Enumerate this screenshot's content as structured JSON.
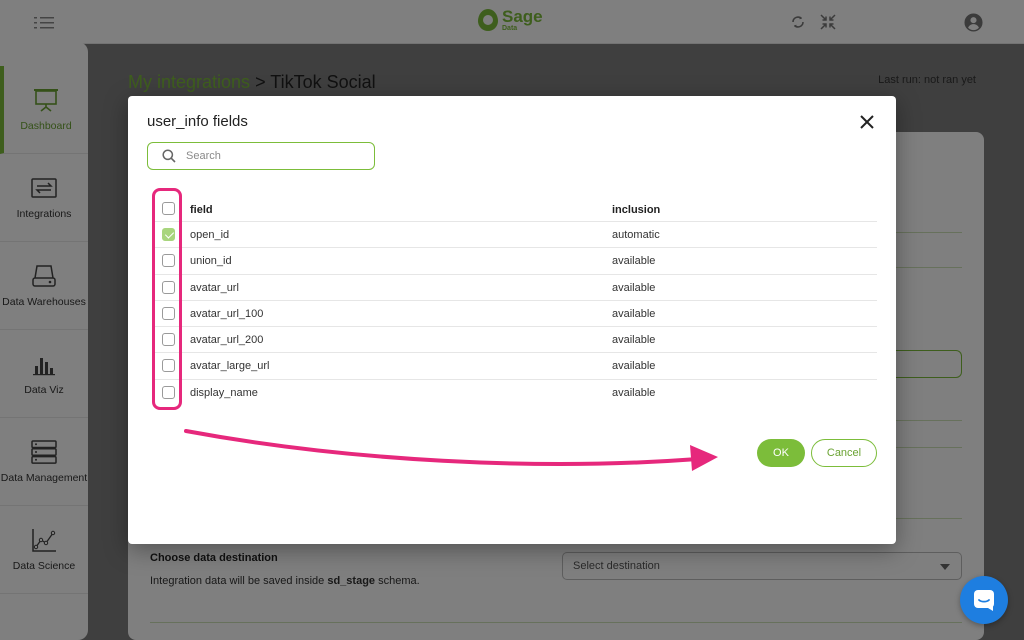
{
  "header": {
    "logo_name": "Sage",
    "logo_sub": "Data",
    "icons": [
      "menu-icon",
      "sync-icon",
      "compress-icon",
      "account-icon"
    ]
  },
  "sidebar": {
    "items": [
      {
        "label": "Dashboard",
        "icon": "presentation-icon",
        "active": true
      },
      {
        "label": "Integrations",
        "icon": "swap-icon"
      },
      {
        "label": "Data Warehouses",
        "icon": "storage-icon"
      },
      {
        "label": "Data Viz",
        "icon": "bar-chart-icon"
      },
      {
        "label": "Data Management",
        "icon": "server-icon"
      },
      {
        "label": "Data Science",
        "icon": "scatter-chart-icon"
      }
    ]
  },
  "page": {
    "breadcrumb_link": "My integrations",
    "breadcrumb_rest": " > TikTok Social",
    "last_run": "Last run: not ran yet",
    "destination_title": "Choose data destination",
    "destination_desc_prefix": "Integration data will be saved inside ",
    "destination_schema": "sd_stage",
    "destination_desc_suffix": " schema.",
    "destination_placeholder": "Select destination"
  },
  "modal": {
    "title": "user_info fields",
    "search_placeholder": "Search",
    "columns": {
      "field": "field",
      "inclusion": "inclusion"
    },
    "rows": [
      {
        "field": "open_id",
        "inclusion": "automatic",
        "checked": true
      },
      {
        "field": "union_id",
        "inclusion": "available",
        "checked": false
      },
      {
        "field": "avatar_url",
        "inclusion": "available",
        "checked": false
      },
      {
        "field": "avatar_url_100",
        "inclusion": "available",
        "checked": false
      },
      {
        "field": "avatar_url_200",
        "inclusion": "available",
        "checked": false
      },
      {
        "field": "avatar_large_url",
        "inclusion": "available",
        "checked": false
      },
      {
        "field": "display_name",
        "inclusion": "available",
        "checked": false
      }
    ],
    "ok_label": "OK",
    "cancel_label": "Cancel"
  },
  "colors": {
    "brand_green": "#7cbd3a",
    "annotation_pink": "#e6287c",
    "chat_blue": "#1e7ee0"
  }
}
